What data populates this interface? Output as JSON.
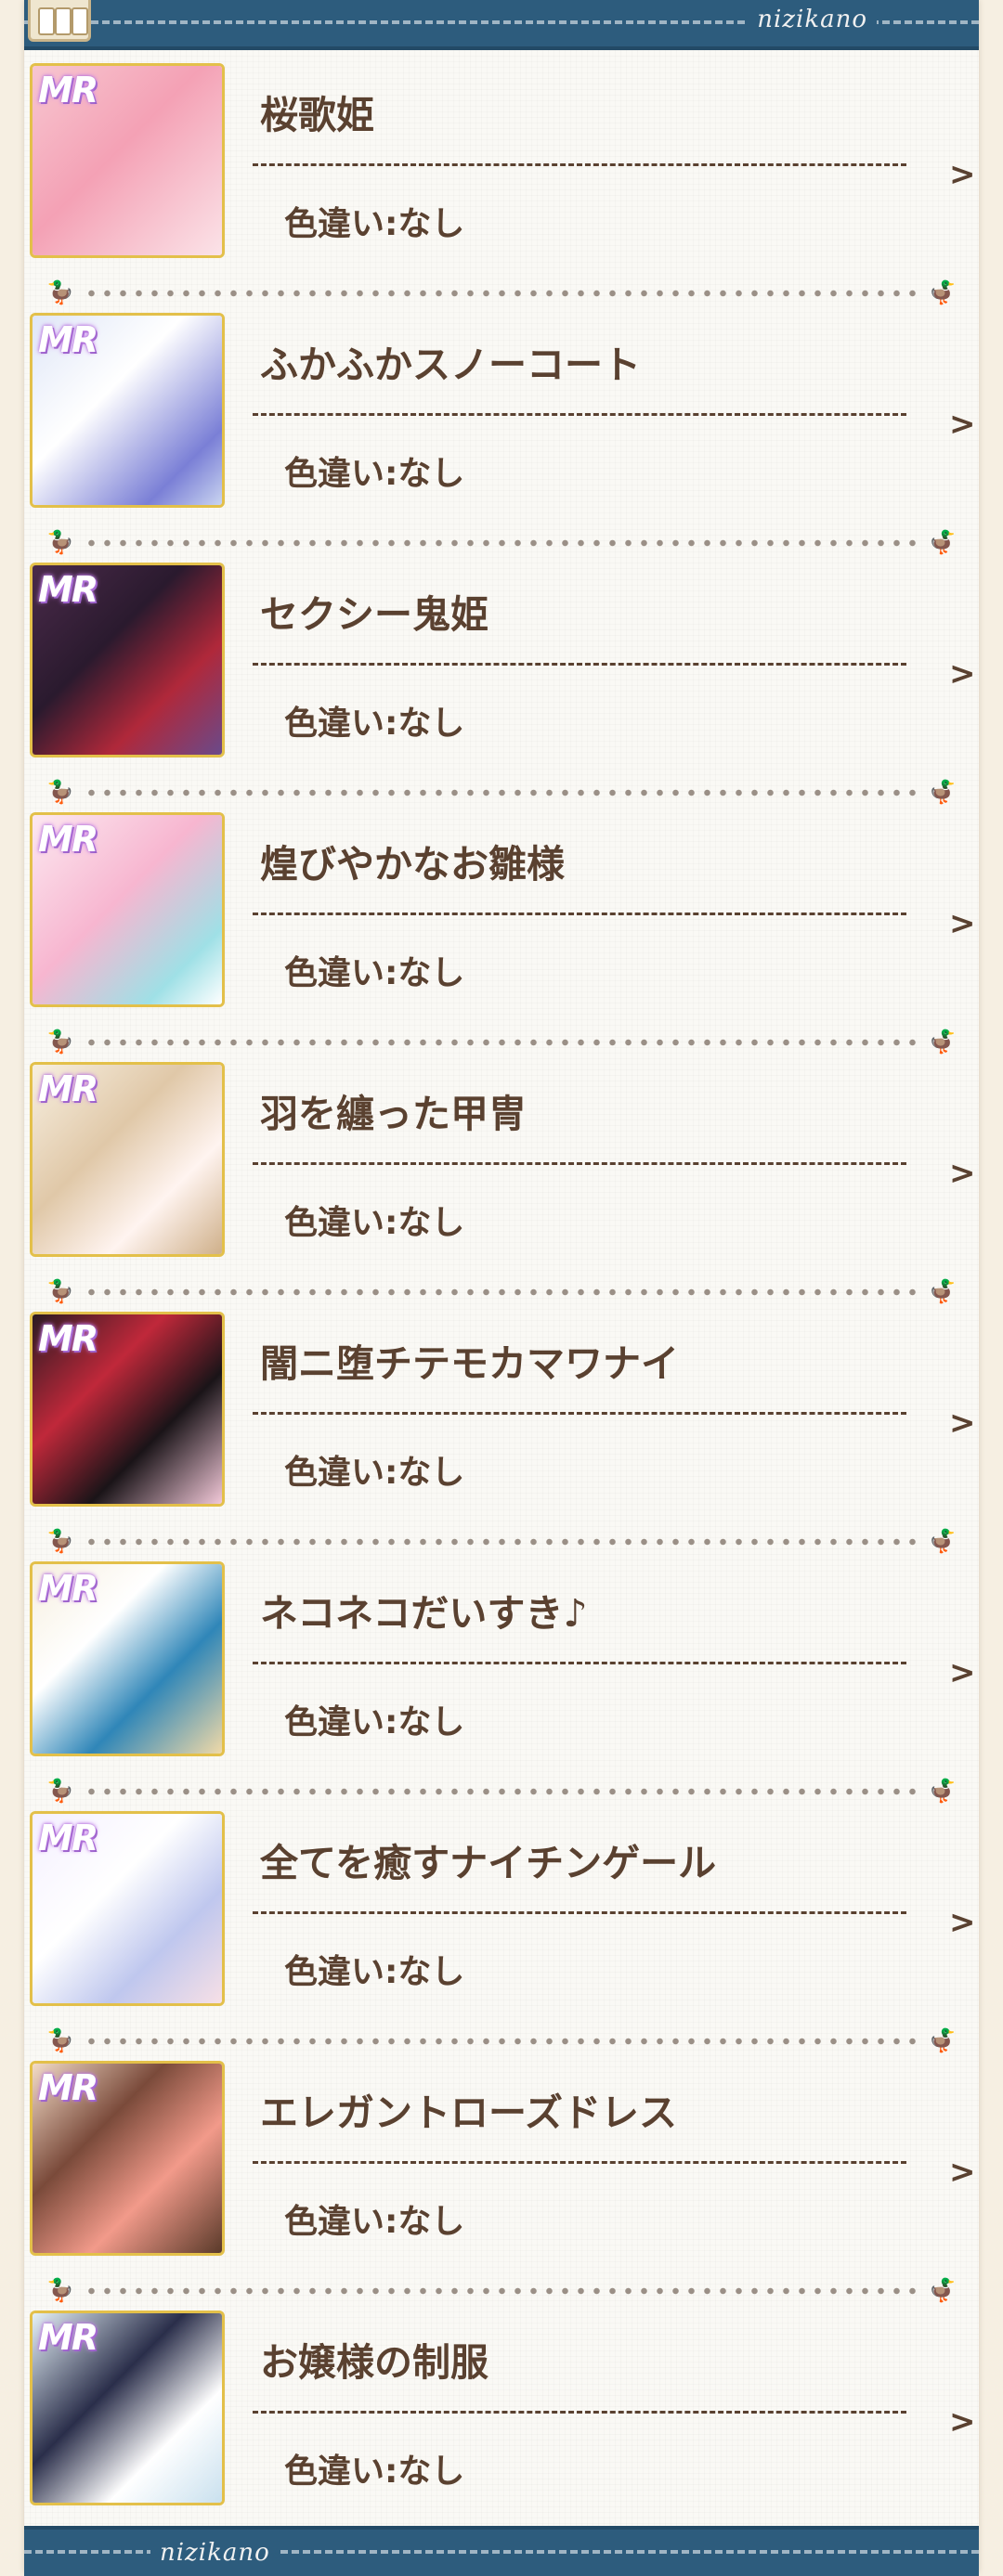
{
  "header": {
    "brand": "nizikano"
  },
  "footer": {
    "brand": "nizikano"
  },
  "rarity_badge": "MR",
  "items": [
    {
      "name": "桜歌姫",
      "color": "色違い:なし",
      "chevron": ">",
      "bg": "linear-gradient(135deg,#f7c6d0 0%,#f4a1b5 45%,#fbe3e8 100%)"
    },
    {
      "name": "ふかふかスノーコート",
      "color": "色違い:なし",
      "chevron": ">",
      "bg": "linear-gradient(135deg,#dfe6f7 0%,#ffffff 40%,#7a7fd6 80%,#c9d4f0 100%)"
    },
    {
      "name": "セクシー鬼姫",
      "color": "色違い:なし",
      "chevron": ">",
      "bg": "linear-gradient(135deg,#4a2a4a 0%,#2a1a2e 40%,#b0283a 70%,#6a4a8a 100%)"
    },
    {
      "name": "煌びやかなお雛様",
      "color": "色違い:なし",
      "chevron": ">",
      "bg": "linear-gradient(135deg,#fce8f0 0%,#f7b6d0 45%,#9fe0e6 80%,#ffffff 100%)"
    },
    {
      "name": "羽を纏った甲冑",
      "color": "色違い:なし",
      "chevron": ">",
      "bg": "linear-gradient(135deg,#f7efe0 0%,#e0c8a8 40%,#fff4f0 70%,#cfb08a 100%)"
    },
    {
      "name": "闇ニ堕チテモカマワナイ",
      "color": "色違い:なし",
      "chevron": ">",
      "bg": "linear-gradient(135deg,#2a1a22 0%,#c0283a 35%,#1a1418 65%,#f2c8d8 100%)"
    },
    {
      "name": "ネコネコだいすき♪",
      "color": "色違い:なし",
      "chevron": ">",
      "bg": "linear-gradient(135deg,#f6efdf 0%,#ffffff 35%,#2f86b8 65%,#f0d9a8 100%)"
    },
    {
      "name": "全てを癒すナイチンゲール",
      "color": "色違い:なし",
      "chevron": ">",
      "bg": "linear-gradient(135deg,#f4f0ff 0%,#ffffff 40%,#bfc7ee 70%,#f7e0e6 100%)"
    },
    {
      "name": "エレガントローズドレス",
      "color": "色違い:なし",
      "chevron": ">",
      "bg": "linear-gradient(135deg,#f3dcc8 0%,#7a4a3a 35%,#f29a8a 65%,#5a3a2a 100%)"
    },
    {
      "name": "お嬢様の制服",
      "color": "色違い:なし",
      "chevron": ">",
      "bg": "linear-gradient(135deg,#e6f2f8 0%,#2a2e4a 40%,#ffffff 70%,#c9e0ee 100%)"
    }
  ]
}
